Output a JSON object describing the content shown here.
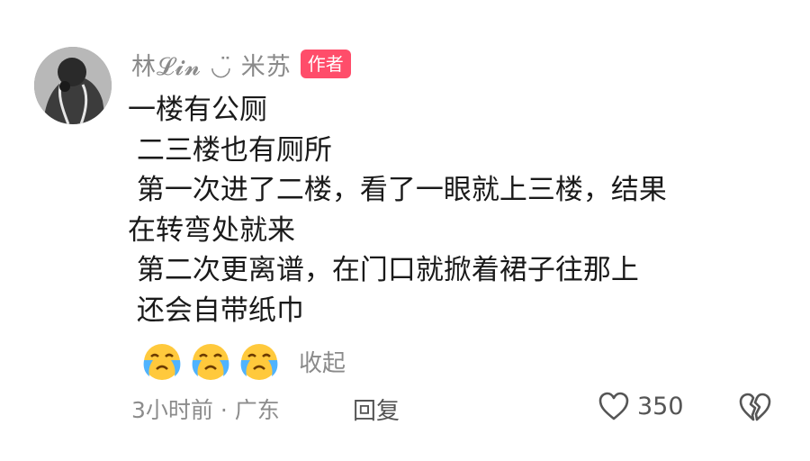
{
  "comment": {
    "username": "林𝓛𝓲𝓷 ◡̈ 米苏",
    "author_badge": "作者",
    "lines": [
      "一楼有公厕",
      " 二三楼也有厕所",
      " 第一次进了二楼，看了一眼就上三楼，结果",
      "在转弯处就来",
      " 第二次更离谱，在门口就掀着裙子往那上",
      " 还会自带纸巾"
    ],
    "emojis": [
      "crying-face-icon",
      "crying-face-icon",
      "crying-face-icon"
    ],
    "collapse_label": "收起",
    "meta": "3小时前 · 广东",
    "reply_label": "回复",
    "like_count": "350"
  },
  "colors": {
    "badge": "#ff4d6a",
    "secondary_text": "#8a8a8a",
    "primary_text": "#1a1a1a"
  }
}
